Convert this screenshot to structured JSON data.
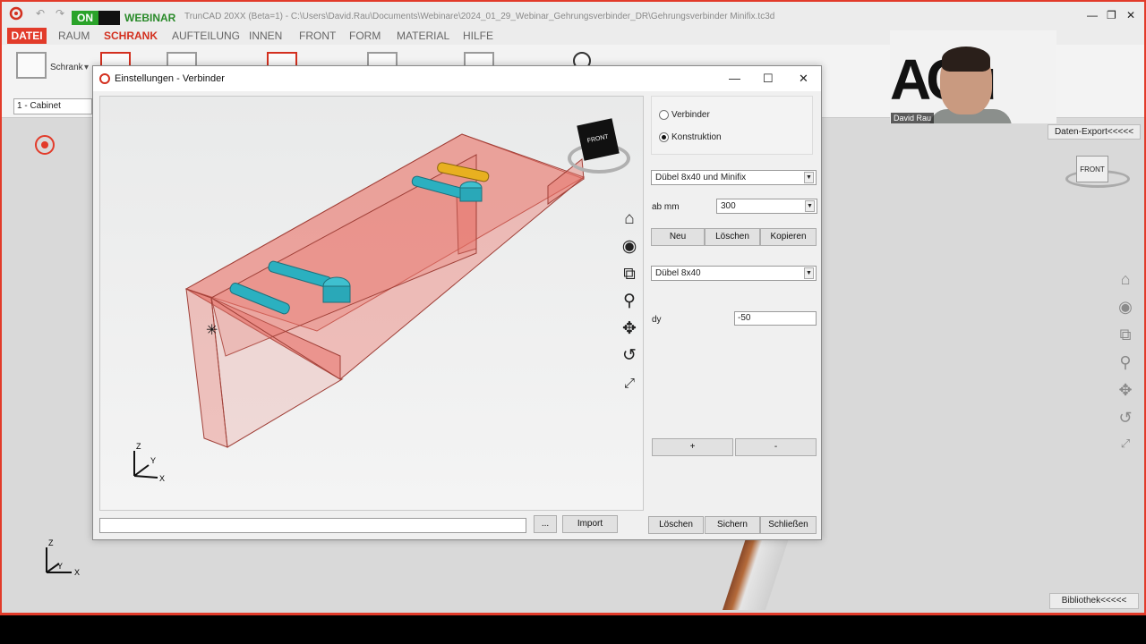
{
  "window": {
    "on_label": "ON",
    "webinar_label": "WEBINAR",
    "title": "TrunCAD 20XX (Beta=1) - C:\\Users\\David.Rau\\Documents\\Webinare\\2024_01_29_Webinar_Gehrungsverbinder_DR\\Gehrungsverbinder Minifix.tc3d"
  },
  "menu": {
    "items": [
      "DATEI",
      "RAUM",
      "SCHRANK",
      "AUFTEILUNG",
      "INNEN",
      "FRONT",
      "FORM",
      "MATERIAL",
      "HILFE"
    ],
    "active": "SCHRANK"
  },
  "ribbon": {
    "schrank_label": "Schrank",
    "cabinet_select": "1 - Cabinet"
  },
  "right_panel": {
    "daten_export": "Daten-Export<<<<<",
    "bibliothek": "Bibliothek<<<<<",
    "cube_label": "FRONT"
  },
  "webcam": {
    "name": "David Rau",
    "logo_text": "ACu"
  },
  "dialog": {
    "title": "Einstellungen - Verbinder",
    "radio_verbinder": "Verbinder",
    "radio_konstruktion": "Konstruktion",
    "selected_radio": "Konstruktion",
    "connector_select": "Dübel 8x40 und Minifix",
    "ab_mm_label": "ab mm",
    "ab_mm_value": "300",
    "btn_neu": "Neu",
    "btn_loeschen_top": "Löschen",
    "btn_kopieren": "Kopieren",
    "part_select": "Dübel 8x40",
    "dy_label": "dy",
    "dy_value": "-50",
    "btn_plus": "+",
    "btn_minus": "-",
    "btn_dots": "...",
    "btn_import": "Import",
    "btn_loeschen": "Löschen",
    "btn_sichern": "Sichern",
    "btn_schliessen": "Schließen",
    "viewport": {
      "cube_label": "FRONT",
      "axis_z": "Z",
      "axis_y": "Y",
      "axis_x": "X"
    }
  },
  "main_axis": {
    "z": "Z",
    "y": "Y",
    "x": "X"
  }
}
